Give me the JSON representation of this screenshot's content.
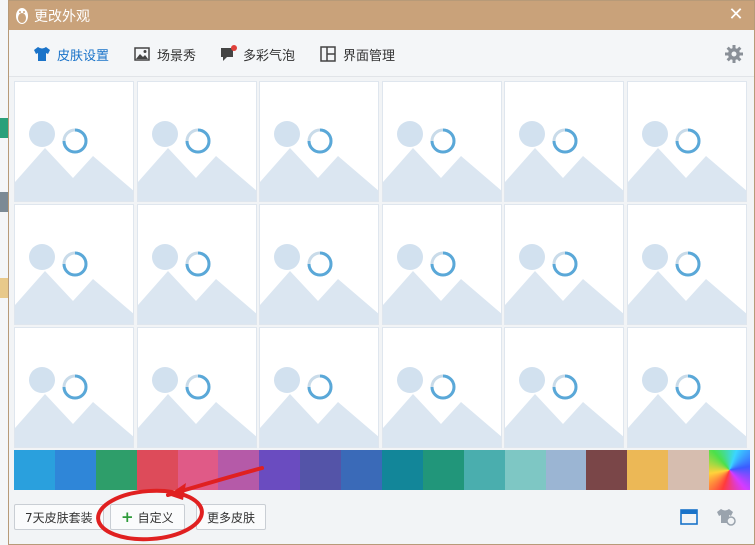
{
  "window": {
    "title": "更改外观",
    "close_glyph": "✕"
  },
  "tabs": [
    {
      "label": "皮肤设置",
      "icon": "tshirt-icon",
      "active": true
    },
    {
      "label": "场景秀",
      "icon": "image-icon",
      "active": false
    },
    {
      "label": "多彩气泡",
      "icon": "chat-bubble-icon",
      "active": false
    },
    {
      "label": "界面管理",
      "icon": "layout-icon",
      "active": false
    }
  ],
  "skin_tiles": {
    "rows": 3,
    "columns": 6,
    "state": "loading",
    "placeholder_icon": "image-placeholder-icon"
  },
  "color_swatches": [
    "#2aa0dd",
    "#2f86d8",
    "#2e9e6a",
    "#dd4b5a",
    "#e05a87",
    "#b55aa8",
    "#6a4cc0",
    "#5454a8",
    "#3a6ab8",
    "#128699",
    "#21967a",
    "#4aaeae",
    "#7ec7c4",
    "#9bb5d3",
    "#7a4648",
    "#ecb856",
    "#d6bdaf",
    "rainbow"
  ],
  "footer": {
    "seven_day_suite": "7天皮肤套装",
    "custom": "自定义",
    "more_skins": "更多皮肤"
  },
  "annotation": {
    "color": "#e02020"
  },
  "colors": {
    "titlebar": "#c9a27a",
    "accent": "#1a73c9"
  }
}
